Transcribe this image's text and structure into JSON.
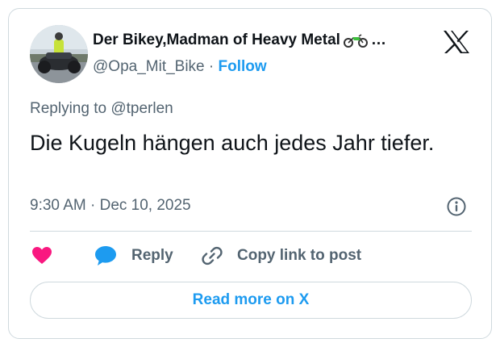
{
  "author": {
    "display_name": "Der Bikey,Madman of Heavy Metal",
    "name_emoji": "motorcycle-icon",
    "truncation": "…",
    "handle": "@Opa_Mit_Bike",
    "separator": "·",
    "follow_label": "Follow"
  },
  "reply_context": {
    "prefix": "Replying to",
    "target": "@tperlen"
  },
  "tweet": {
    "text": "Die Kugeln hängen auch jedes Jahr tiefer.",
    "timestamp": "9:30 AM · Dec 10, 2025"
  },
  "actions": {
    "like_icon": "heart-icon",
    "reply_label": "Reply",
    "copy_label": "Copy link to post"
  },
  "footer": {
    "read_more_label": "Read more on X"
  },
  "colors": {
    "accent": "#1d9bf0",
    "like": "#f91880",
    "muted": "#536471",
    "text": "#0f1419",
    "border": "#cfd9de"
  }
}
